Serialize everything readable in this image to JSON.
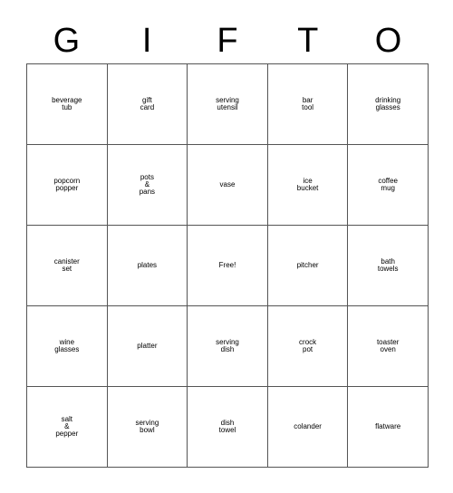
{
  "card": {
    "type": "bingo-card",
    "header_letters": [
      "G",
      "I",
      "F",
      "T",
      "O"
    ],
    "columns": 5,
    "rows": 5,
    "border_color": "#555555",
    "text_color": "#000000",
    "background_color": "#ffffff",
    "free_space": {
      "row": 3,
      "column": 3,
      "label": "Free!"
    },
    "rows_data": [
      [
        {
          "label": "beverage\ntub",
          "size": "xs"
        },
        {
          "label": "gift\ncard",
          "size": "xxl"
        },
        {
          "label": "serving\nutensil",
          "size": "md"
        },
        {
          "label": "bar\ntool",
          "size": "xxl"
        },
        {
          "label": "drinking\nglasses",
          "size": "sm"
        }
      ],
      [
        {
          "label": "popcorn\npopper",
          "size": "md"
        },
        {
          "label": "pots\n&\npans",
          "size": "md"
        },
        {
          "label": "vase",
          "size": "huge"
        },
        {
          "label": "ice\nbucket",
          "size": "lg"
        },
        {
          "label": "coffee\nmug",
          "size": "xl"
        }
      ],
      [
        {
          "label": "canister\nset",
          "size": "md"
        },
        {
          "label": "plates",
          "size": "lg"
        },
        {
          "label": "Free!",
          "size": "xl"
        },
        {
          "label": "pitcher",
          "size": "md"
        },
        {
          "label": "bath\ntowels",
          "size": "xl"
        }
      ],
      [
        {
          "label": "wine\nglasses",
          "size": "md"
        },
        {
          "label": "platter",
          "size": "lg"
        },
        {
          "label": "serving\ndish",
          "size": "md"
        },
        {
          "label": "crock\npot",
          "size": "xl"
        },
        {
          "label": "toaster\noven",
          "size": "md"
        }
      ],
      [
        {
          "label": "salt\n&\npepper",
          "size": "md"
        },
        {
          "label": "serving\nbowl",
          "size": "md"
        },
        {
          "label": "dish\ntowel",
          "size": "xl"
        },
        {
          "label": "colander",
          "size": "sm"
        },
        {
          "label": "flatware",
          "size": "md"
        }
      ]
    ]
  }
}
